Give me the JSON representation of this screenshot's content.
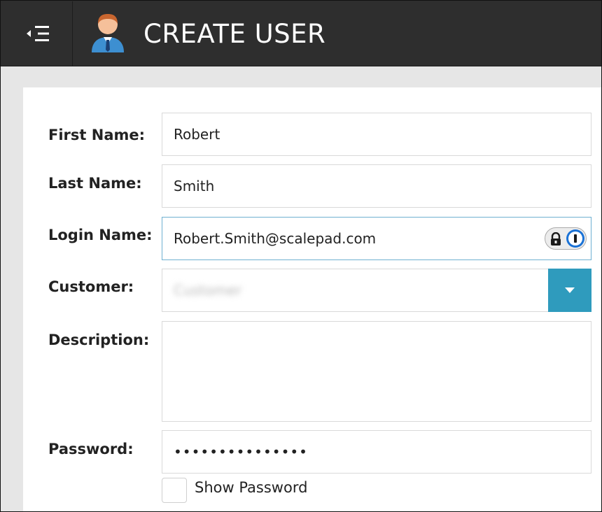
{
  "header": {
    "title": "CREATE USER",
    "menu_icon": "menu-collapse-icon",
    "user_icon": "user-avatar-icon"
  },
  "form": {
    "first_name": {
      "label": "First Name:",
      "value": "Robert"
    },
    "last_name": {
      "label": "Last Name:",
      "value": "Smith"
    },
    "login_name": {
      "label": "Login Name:",
      "value": "Robert.Smith@scalepad.com"
    },
    "customer": {
      "label": "Customer:",
      "value": "Customer"
    },
    "description": {
      "label": "Description:",
      "value": ""
    },
    "password": {
      "label": "Password:",
      "value": "•••••••••••••••"
    },
    "show_password": {
      "label": "Show Password",
      "checked": false
    }
  },
  "colors": {
    "header_bg": "#2e2e2e",
    "accent": "#2f9bbd",
    "password_manager": "#1a72d6"
  }
}
